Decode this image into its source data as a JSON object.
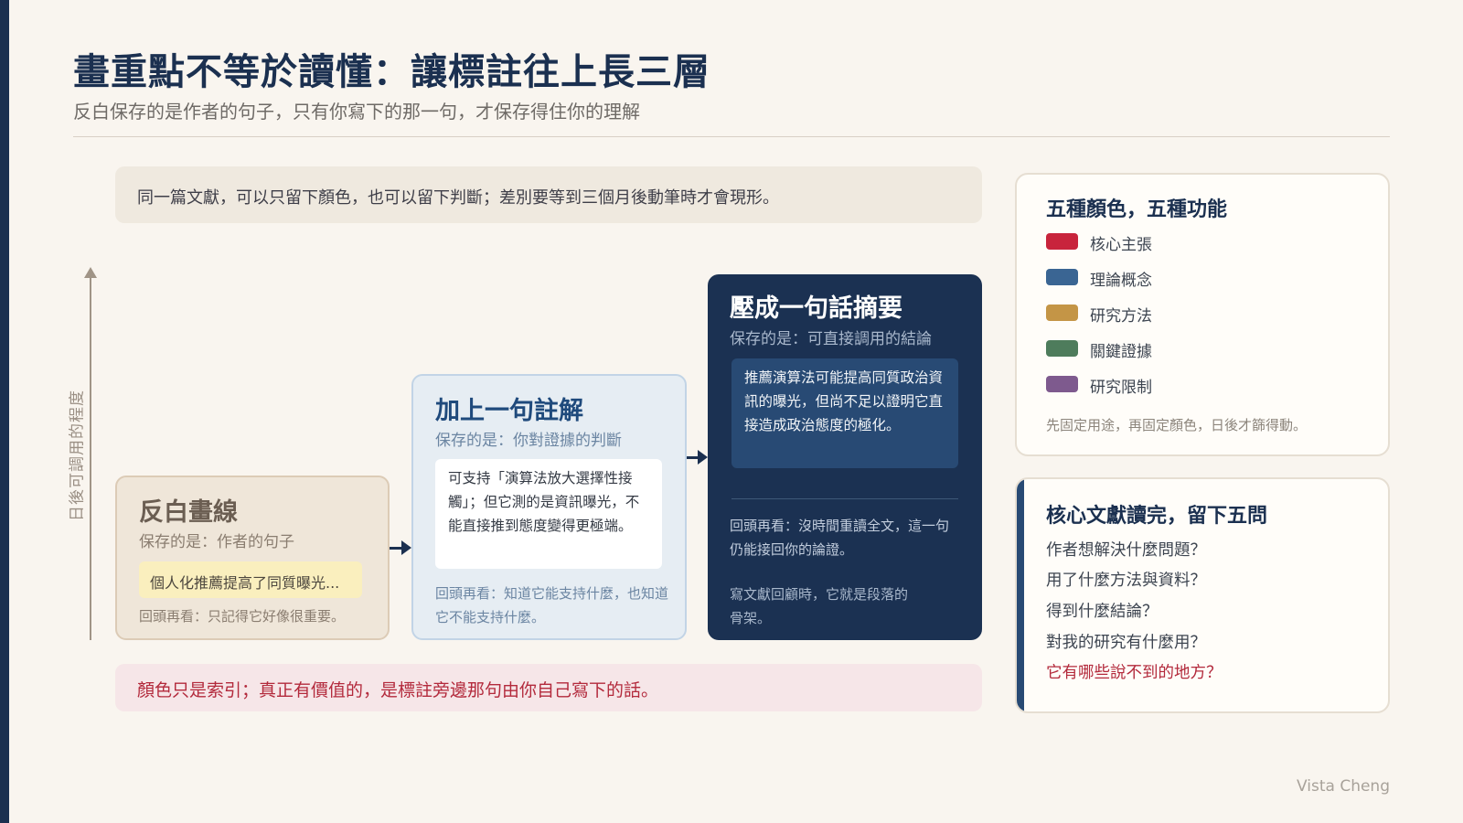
{
  "title": "畫重點不等於讀懂：讓標註往上長三層",
  "subtitle": "反白保存的是作者的句子，只有你寫下的那一句，才保存得住你的理解",
  "intro": "同一篇文獻，可以只留下顏色，也可以留下判斷；差別要等到三個月後動筆時才會現形。",
  "axis_label": "日後可調用的程度",
  "levels": [
    {
      "title": "反白畫線",
      "subtitle": "保存的是：作者的句子",
      "content": "個人化推薦提高了同質曝光...",
      "footer": "回頭再看：只記得它好像很重要。"
    },
    {
      "title": "加上一句註解",
      "subtitle": "保存的是：你對證據的判斷",
      "content": "可支持「演算法放大選擇性接觸」；但它測的是資訊曝光，不能直接推到態度變得更極端。",
      "footer": "回頭再看：知道它能支持什麼，也知道它不能支持什麼。"
    },
    {
      "title": "壓成一句話摘要",
      "subtitle": "保存的是：可直接調用的結論",
      "content": "推薦演算法可能提高同質政治資訊的曝光，但尚不足以證明它直接造成政治態度的極化。",
      "footer": "回頭再看：沒時間重讀全文，這一句仍能接回你的論證。",
      "extra": "寫文獻回顧時，它就是段落的骨架。"
    }
  ],
  "bottom_note": "顏色只是索引；真正有價值的，是標註旁邊那句由你自己寫下的話。",
  "legend": {
    "title": "五種顏色，五種功能",
    "items": [
      {
        "label": "核心主張",
        "color": "#c8243c"
      },
      {
        "label": "理論概念",
        "color": "#3a6593"
      },
      {
        "label": "研究方法",
        "color": "#c49546"
      },
      {
        "label": "關鍵證據",
        "color": "#4e7c5c"
      },
      {
        "label": "研究限制",
        "color": "#7e5a8e"
      }
    ],
    "note": "先固定用途，再固定顏色，日後才篩得動。"
  },
  "questions": {
    "title": "核心文獻讀完，留下五問",
    "items": [
      "作者想解決什麼問題？",
      "用了什麼方法與資料？",
      "得到什麼結論？",
      "對我的研究有什麼用？",
      "它有哪些說不到的地方？"
    ]
  },
  "signature": "Vista Cheng"
}
